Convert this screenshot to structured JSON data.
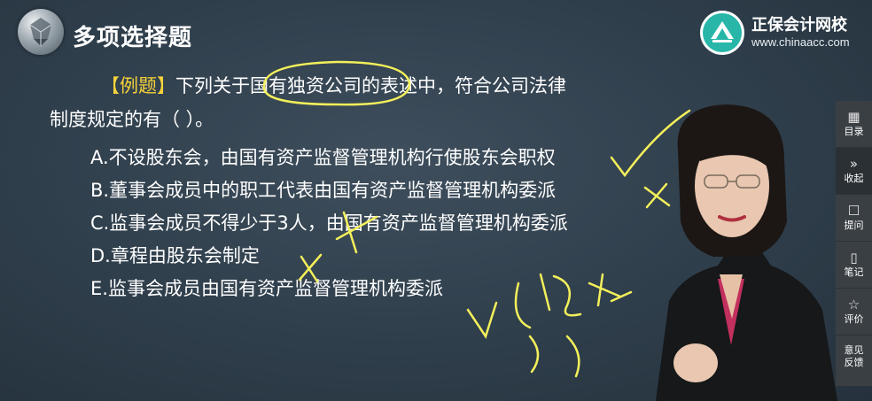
{
  "header": {
    "title": "多项选择题"
  },
  "brand": {
    "name": "正保会计网校",
    "url": "www.chinaacc.com"
  },
  "question": {
    "tag": "【例题】",
    "text_line1": "下列关于国有独资公司的表述中，符合公司法律",
    "text_line2": "制度规定的有（    ）。"
  },
  "options": [
    {
      "text": "A.不设股东会，由国有资产监督管理机构行使股东会职权"
    },
    {
      "text": "B.董事会成员中的职工代表由国有资产监督管理机构委派"
    },
    {
      "text": "C.监事会成员不得少于3人，由国有资产监督管理机构委派"
    },
    {
      "text": "D.章程由股东会制定"
    },
    {
      "text": "E.监事会成员由国有资产监督管理机构委派"
    }
  ],
  "sidebar": {
    "items": [
      {
        "label": "目录",
        "icon": "grid-icon"
      },
      {
        "label": "收起",
        "icon": "collapse-icon"
      },
      {
        "label": "提问",
        "icon": "chat-icon"
      },
      {
        "label": "笔记",
        "icon": "note-icon"
      },
      {
        "label": "评价",
        "icon": "star-icon"
      },
      {
        "label": "意见\n反馈",
        "label_line1": "意见",
        "label_line2": "反馈",
        "icon": "feedback-icon"
      }
    ]
  },
  "colors": {
    "annotation": "#f3f05a",
    "tag": "#f6d23a",
    "background": "#334350",
    "sidebar": "#3a3f44"
  }
}
